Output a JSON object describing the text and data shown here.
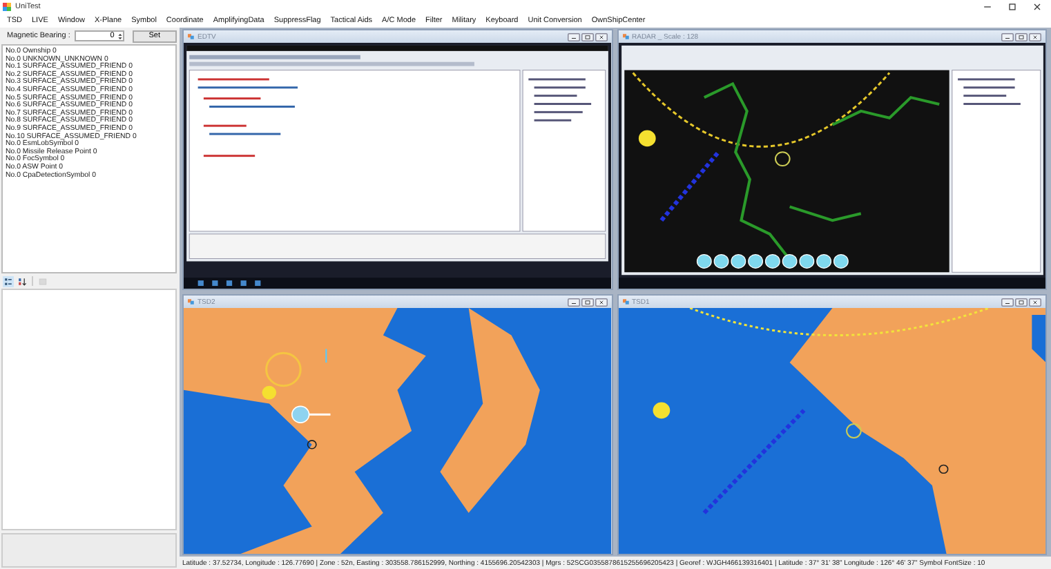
{
  "window": {
    "title": "UniTest"
  },
  "menu": [
    "TSD",
    "LIVE",
    "Window",
    "X-Plane",
    "Symbol",
    "Coordinate",
    "AmplifyingData",
    "SuppressFlag",
    "Tactical Aids",
    "A/C Mode",
    "Filter",
    "Military",
    "Keyboard",
    "Unit Conversion",
    "OwnShipCenter"
  ],
  "bearing": {
    "label": "Magnetic Bearing :",
    "value": "0",
    "button": "Set"
  },
  "symbols": [
    "No.0 Ownship 0",
    "No.0 UNKNOWN_UNKNOWN 0",
    "No.1 SURFACE_ASSUMED_FRIEND 0",
    "No.2 SURFACE_ASSUMED_FRIEND 0",
    "No.3 SURFACE_ASSUMED_FRIEND 0",
    "No.4 SURFACE_ASSUMED_FRIEND 0",
    "No.5 SURFACE_ASSUMED_FRIEND 0",
    "No.6 SURFACE_ASSUMED_FRIEND 0",
    "No.7 SURFACE_ASSUMED_FRIEND 0",
    "No.8 SURFACE_ASSUMED_FRIEND 0",
    "No.9 SURFACE_ASSUMED_FRIEND 0",
    "No.10 SURFACE_ASSUMED_FRIEND 0",
    "No.0 EsmLobSymbol 0",
    "No.0 Missile Release Point 0",
    "No.0 FocSymbol 0",
    "No.0  ASW Point 0",
    "No.0 CpaDetectionSymbol 0"
  ],
  "toolbar": [
    {
      "kind": "categorized",
      "selected": true,
      "disabled": false
    },
    {
      "kind": "alphabetical",
      "selected": false,
      "disabled": false
    },
    {
      "kind": "pages",
      "selected": false,
      "disabled": true
    }
  ],
  "panes": [
    {
      "title": "EDTV",
      "kind": "screen"
    },
    {
      "title": "RADAR _ Scale : 128",
      "kind": "radar"
    },
    {
      "title": "TSD2",
      "kind": "map2"
    },
    {
      "title": "TSD1",
      "kind": "map1"
    }
  ],
  "status_bar": "Latitude : 37.52734, Longitude : 126.77690  |  Zone : 52n, Easting : 303558.786152999, Northing : 4155696.20542303  |  Mgrs : 52SCG0355878615255696205423  |  Georef : WJGH466139316401  |  Latitude : 37° 31' 38\"  Longitude : 126° 46' 37\"  Symbol FontSize : 10"
}
